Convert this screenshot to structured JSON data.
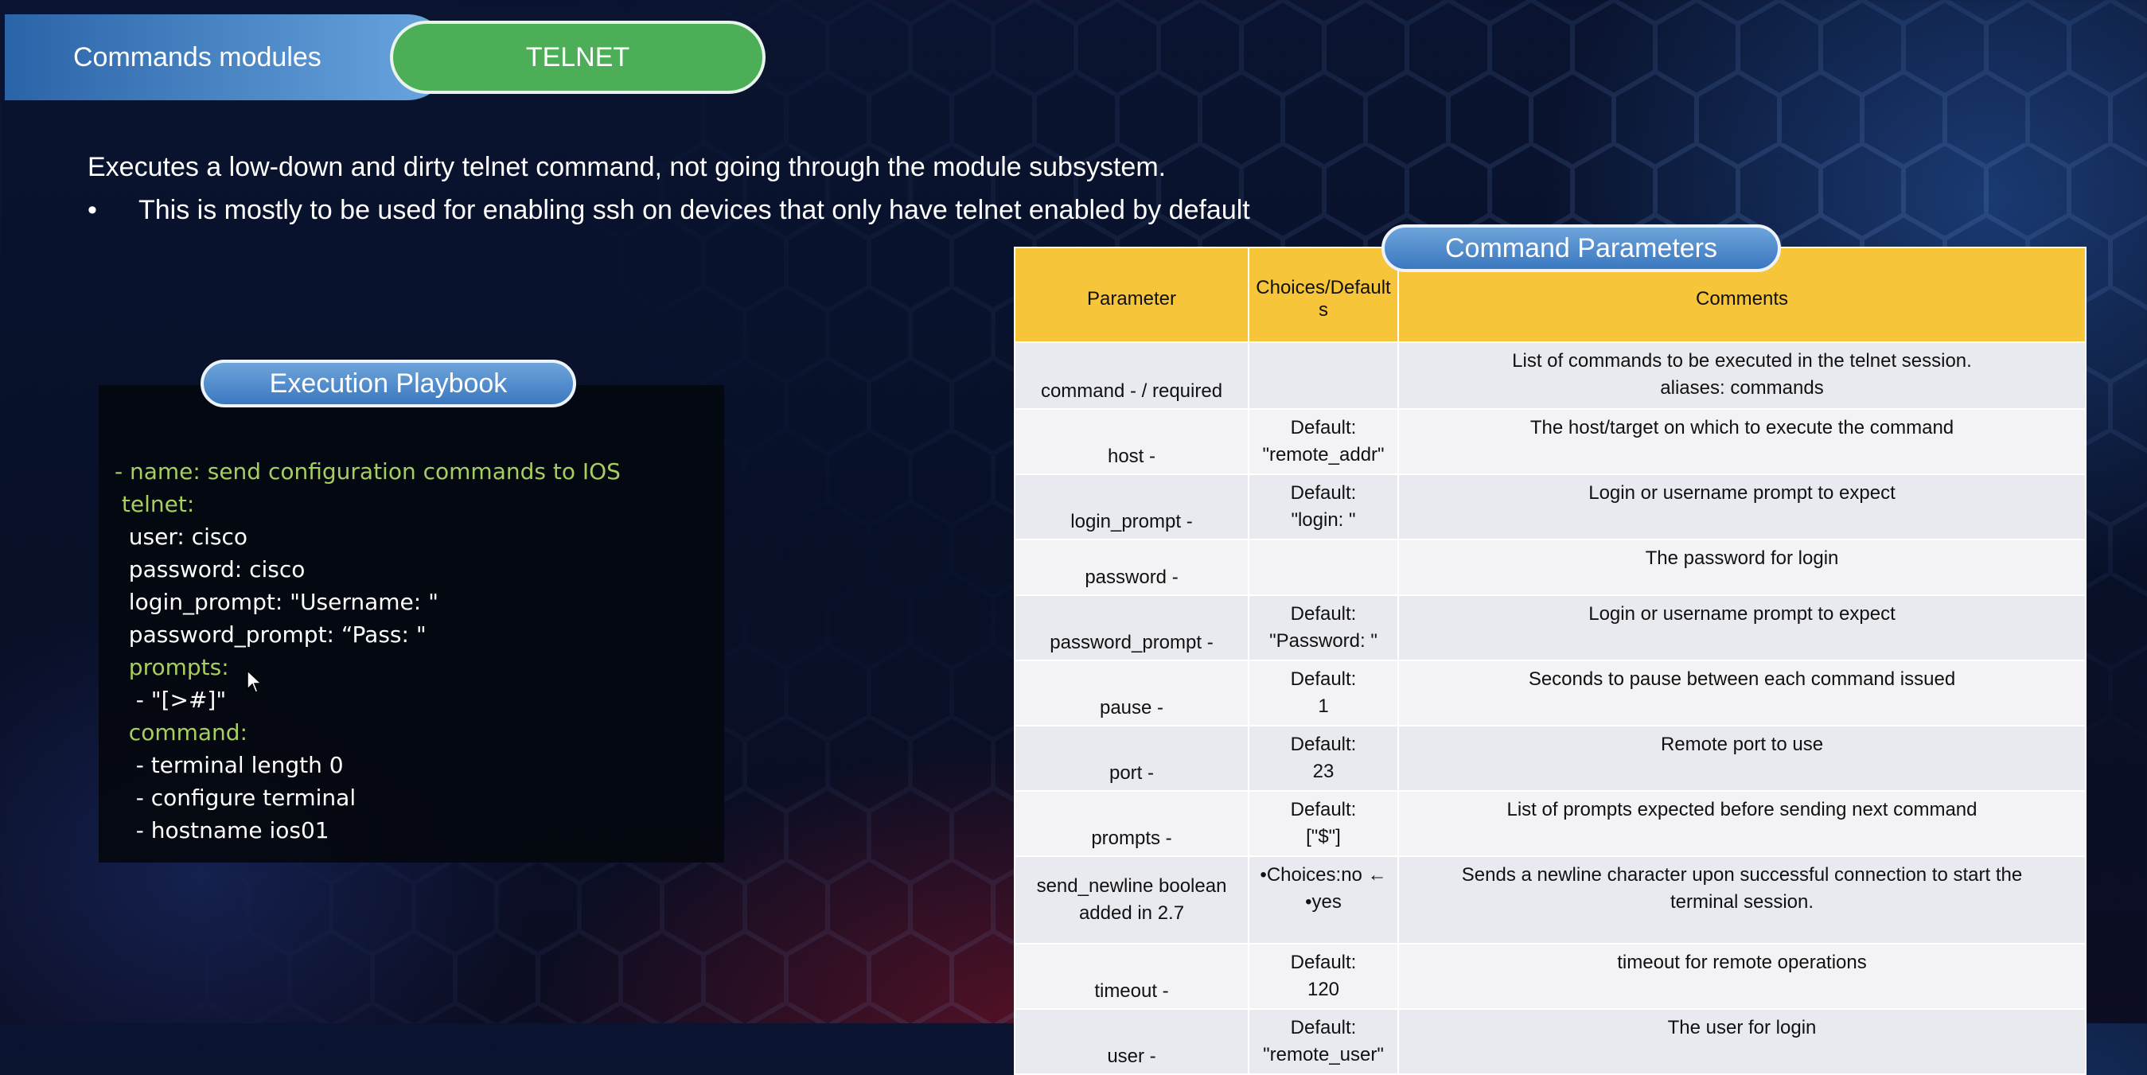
{
  "tabs": {
    "modules_label": "Commands modules",
    "telnet_label": "TELNET"
  },
  "intro": {
    "description": "Executes a low-down and dirty telnet command, not going through the module subsystem.",
    "bullet_dot": "•",
    "bullet": "This is mostly to be used for enabling ssh on devices that only have telnet enabled by default"
  },
  "playbook": {
    "title": "Execution Playbook",
    "lines": [
      "- name: send configuration commands to IOS",
      " telnet:",
      "  user: cisco",
      "  password: cisco",
      "  login_prompt: \"Username: \"",
      "  password_prompt: “Pass: \"",
      "  prompts:",
      "   - \"[>#]\"",
      "  command:",
      "   - terminal length 0",
      "   - configure terminal",
      "   - hostname ios01"
    ]
  },
  "parameters": {
    "title": "Command Parameters",
    "headers": [
      "Parameter",
      "Choices/Defaults",
      "Comments"
    ],
    "rows": [
      {
        "parameter": "command - / required",
        "choices": "",
        "comments": "List of commands to be executed in the telnet session.\naliases: commands"
      },
      {
        "parameter": "host -",
        "choices": "Default:\n\"remote_addr\"",
        "comments": "The host/target on which to execute the command"
      },
      {
        "parameter": "login_prompt -",
        "choices": "Default:\n\"login: \"",
        "comments": "Login or username prompt to expect"
      },
      {
        "parameter": "password -",
        "choices": "",
        "comments": "The password for login"
      },
      {
        "parameter": "password_prompt -",
        "choices": "Default:\n\"Password: \"",
        "comments": "Login or username prompt to expect"
      },
      {
        "parameter": "pause -",
        "choices": "Default:\n1",
        "comments": "Seconds to pause between each command issued"
      },
      {
        "parameter": "port -",
        "choices": "Default:\n23",
        "comments": "Remote port to use"
      },
      {
        "parameter": "prompts -",
        "choices": "Default:\n[\"$\"]",
        "comments": "List of prompts expected before sending next command"
      },
      {
        "parameter": "send_newline boolean\nadded in 2.7",
        "choices": "•Choices:no ←\n•yes",
        "comments": "Sends a newline character upon successful connection to start the\nterminal session."
      },
      {
        "parameter": "timeout -",
        "choices": "Default:\n120",
        "comments": "timeout for remote operations"
      },
      {
        "parameter": "user -",
        "choices": "Default:\n\"remote_user\"",
        "comments": "The user for login"
      }
    ]
  },
  "colors": {
    "telnet_green": "#4caf57",
    "header_yellow": "#f7c539",
    "code_green": "#a6cf5f"
  }
}
